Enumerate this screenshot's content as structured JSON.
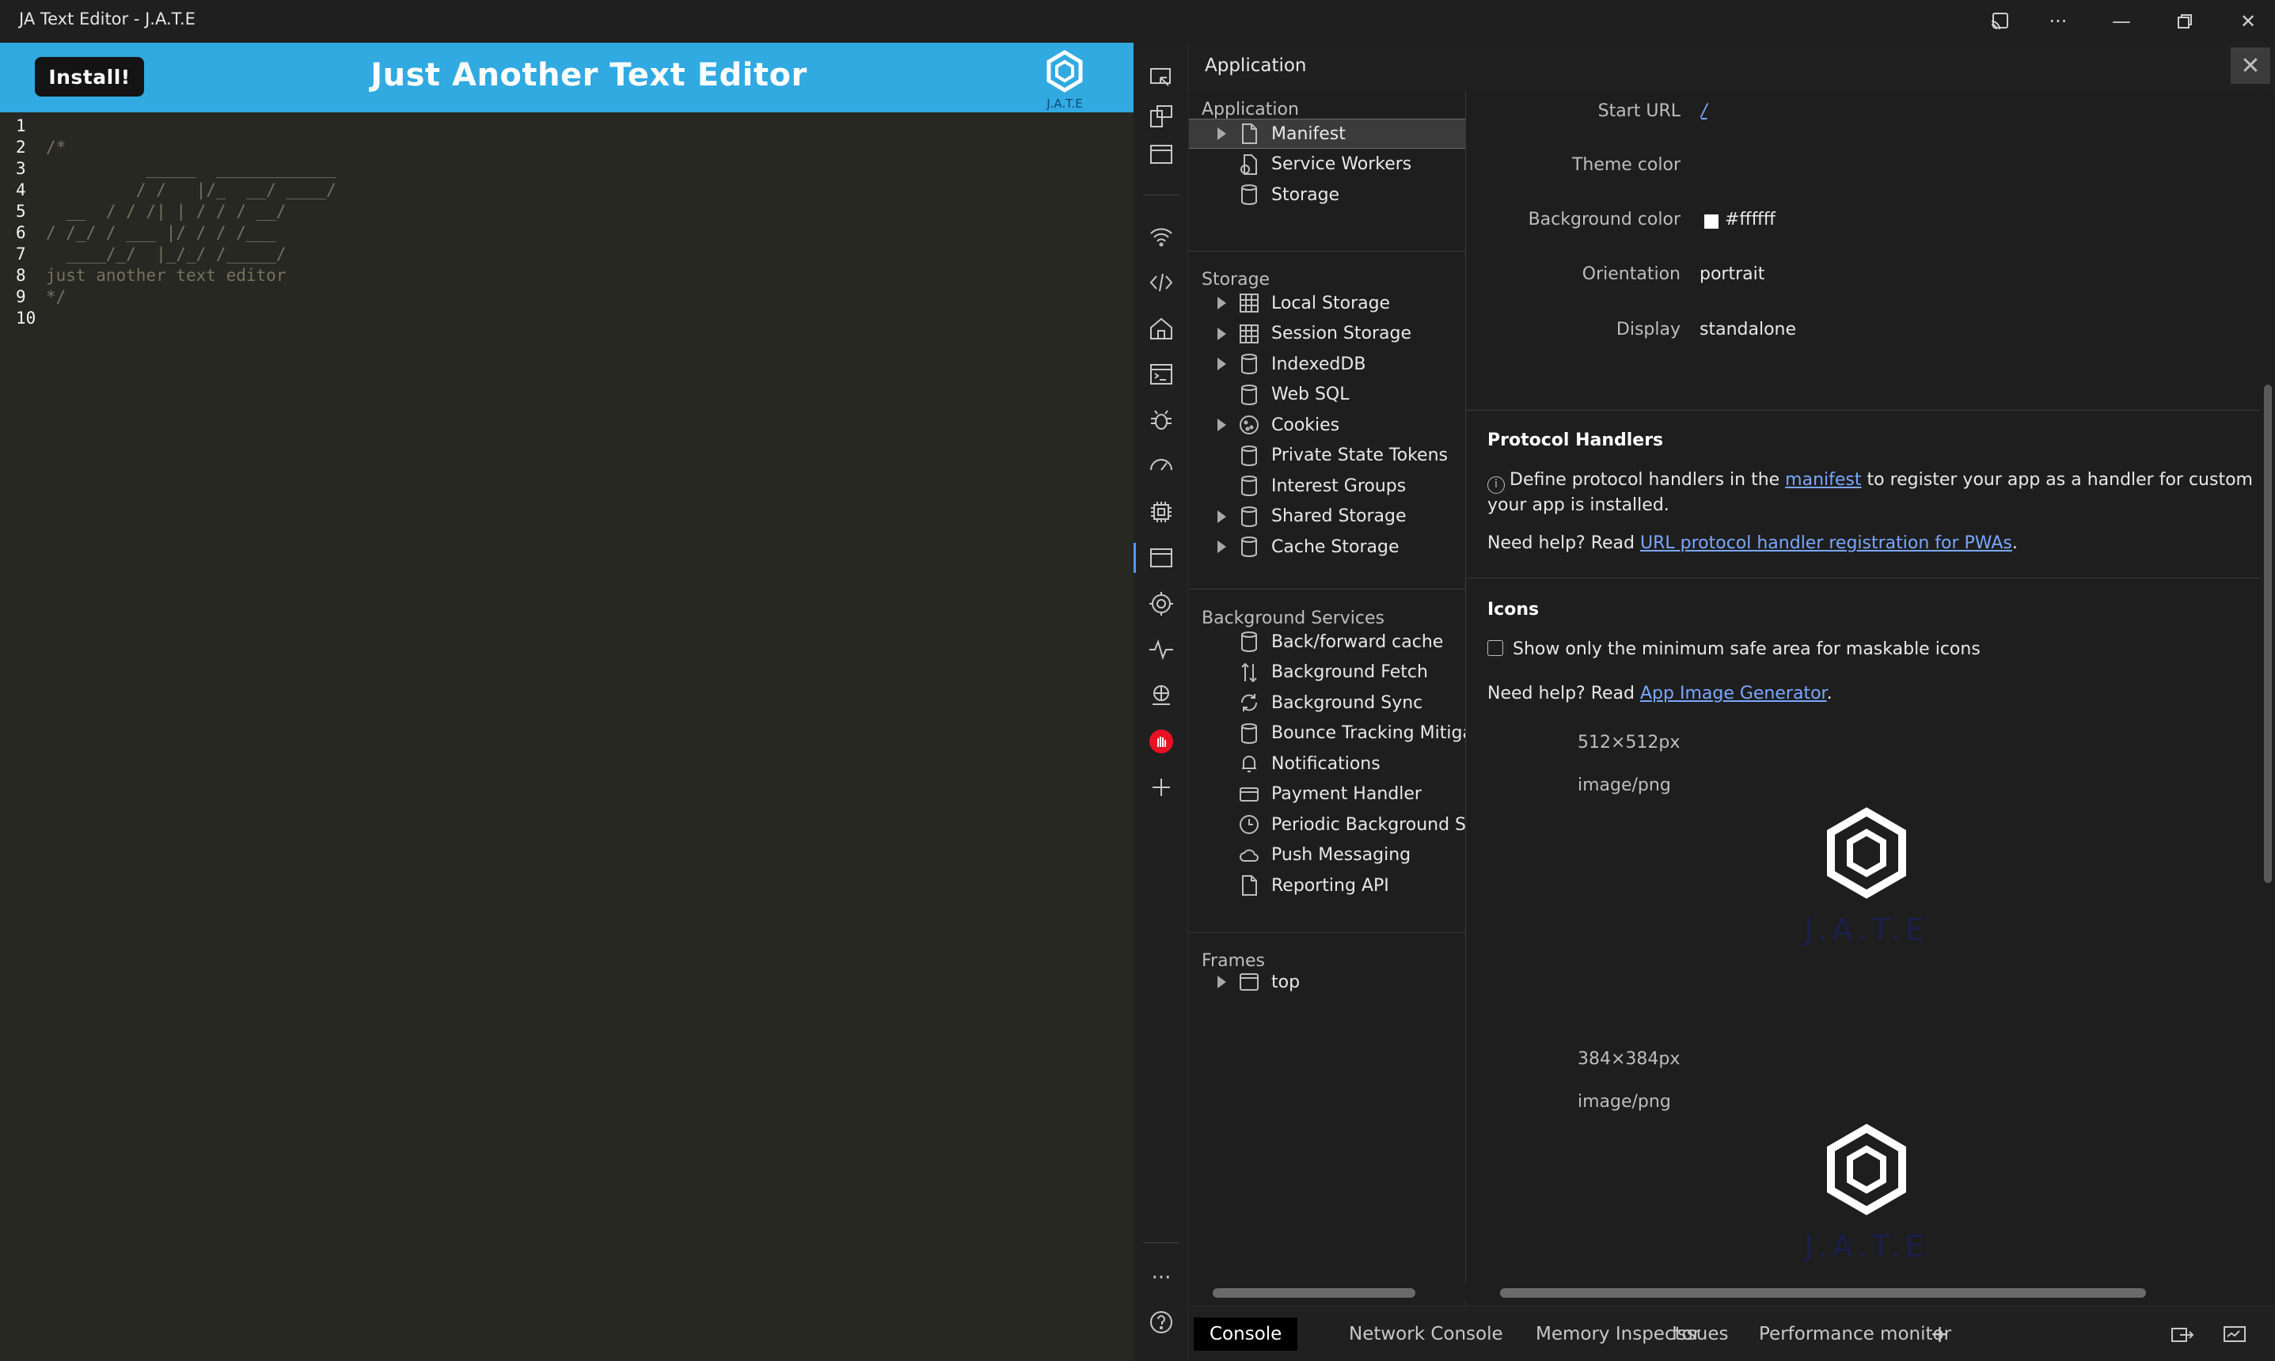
{
  "window": {
    "title": "JA Text Editor - J.A.T.E",
    "controls": [
      "cast-icon",
      "more-icon",
      "minimize-icon",
      "restore-icon",
      "close-icon"
    ]
  },
  "app": {
    "install_label": "Install!",
    "title": "Just Another Text Editor",
    "logo_text": "J.A.T.E",
    "header_color": "#31a9e1",
    "editor_bg": "#272822",
    "lines": [
      {
        "n": "1",
        "text": ""
      },
      {
        "n": "2",
        "text": "/*"
      },
      {
        "n": "3",
        "text": "          _____  ____________"
      },
      {
        "n": "4",
        "text": "         / /   |/_  __/ ____/"
      },
      {
        "n": "5",
        "text": "  __  / / /| | / / / __/"
      },
      {
        "n": "6",
        "text": "/ /_/ / ___ |/ / / /___"
      },
      {
        "n": "7",
        "text": "  ____/_/  |_/_/ /_____/"
      },
      {
        "n": "8",
        "text": "just another text editor"
      },
      {
        "n": "9",
        "text": "*/"
      },
      {
        "n": "10",
        "text": ""
      }
    ]
  },
  "devtools": {
    "panel_title": "Application",
    "close_label": "✕",
    "sidebar": {
      "application_header": "Application",
      "application_items": [
        {
          "label": "Manifest",
          "icon": "file-icon",
          "expandable": true,
          "selected": true
        },
        {
          "label": "Service Workers",
          "icon": "gear-file-icon",
          "expandable": false
        },
        {
          "label": "Storage",
          "icon": "database-icon",
          "expandable": false
        }
      ],
      "storage_header": "Storage",
      "storage_items": [
        {
          "label": "Local Storage",
          "icon": "grid-icon",
          "expandable": true
        },
        {
          "label": "Session Storage",
          "icon": "grid-icon",
          "expandable": true
        },
        {
          "label": "IndexedDB",
          "icon": "database-icon",
          "expandable": true
        },
        {
          "label": "Web SQL",
          "icon": "database-icon",
          "expandable": false
        },
        {
          "label": "Cookies",
          "icon": "cookie-icon",
          "expandable": true
        },
        {
          "label": "Private State Tokens",
          "icon": "database-icon",
          "expandable": false
        },
        {
          "label": "Interest Groups",
          "icon": "database-icon",
          "expandable": false
        },
        {
          "label": "Shared Storage",
          "icon": "database-icon",
          "expandable": true
        },
        {
          "label": "Cache Storage",
          "icon": "database-icon",
          "expandable": true
        }
      ],
      "background_header": "Background Services",
      "background_items": [
        {
          "label": "Back/forward cache",
          "icon": "database-icon"
        },
        {
          "label": "Background Fetch",
          "icon": "arrows-updown-icon"
        },
        {
          "label": "Background Sync",
          "icon": "sync-icon"
        },
        {
          "label": "Bounce Tracking Mitigat",
          "icon": "database-icon"
        },
        {
          "label": "Notifications",
          "icon": "bell-icon"
        },
        {
          "label": "Payment Handler",
          "icon": "card-icon"
        },
        {
          "label": "Periodic Background Syr",
          "icon": "clock-icon"
        },
        {
          "label": "Push Messaging",
          "icon": "cloud-icon"
        },
        {
          "label": "Reporting API",
          "icon": "file-icon"
        }
      ],
      "frames_header": "Frames",
      "frames_items": [
        {
          "label": "top",
          "icon": "window-icon",
          "expandable": true
        }
      ]
    },
    "manifest": {
      "start_url_key": "Start URL",
      "start_url_value": "/",
      "theme_color_key": "Theme color",
      "background_color_key": "Background color",
      "background_color_value": "#ffffff",
      "orientation_key": "Orientation",
      "orientation_value": "portrait",
      "display_key": "Display",
      "display_value": "standalone"
    },
    "protocol": {
      "heading": "Protocol Handlers",
      "info_pre": "Define protocol handlers in the ",
      "info_link": "manifest",
      "info_post": " to register your app as a handler for custom protoc",
      "info_line2": "your app is installed.",
      "help_pre": "Need help? Read ",
      "help_link": "URL protocol handler registration for PWAs",
      "help_post": "."
    },
    "icons": {
      "heading": "Icons",
      "checkbox_label": "Show only the minimum safe area for maskable icons",
      "help_pre": "Need help? Read ",
      "help_link": "App Image Generator",
      "help_post": ".",
      "entries": [
        {
          "size": "512×512px",
          "type": "image/png",
          "logo_text": "J.A.T.E"
        },
        {
          "size": "384×384px",
          "type": "image/png",
          "logo_text": "J.A.T.E"
        }
      ]
    },
    "drawer_tabs": [
      "Console",
      "Network Console",
      "Memory Inspector",
      "Issues",
      "Performance monitor"
    ],
    "drawer_add": "+",
    "activity_icons": [
      "inspect-icon",
      "device-icon",
      "window-icon",
      "wifi-icon",
      "code-icon",
      "home-icon",
      "console-icon",
      "bug-icon",
      "performance-icon",
      "cpu-icon",
      "application-icon",
      "settings-icon",
      "activity-icon",
      "network-icon",
      "block-icon",
      "add-icon",
      "more-icon",
      "help-icon"
    ]
  }
}
